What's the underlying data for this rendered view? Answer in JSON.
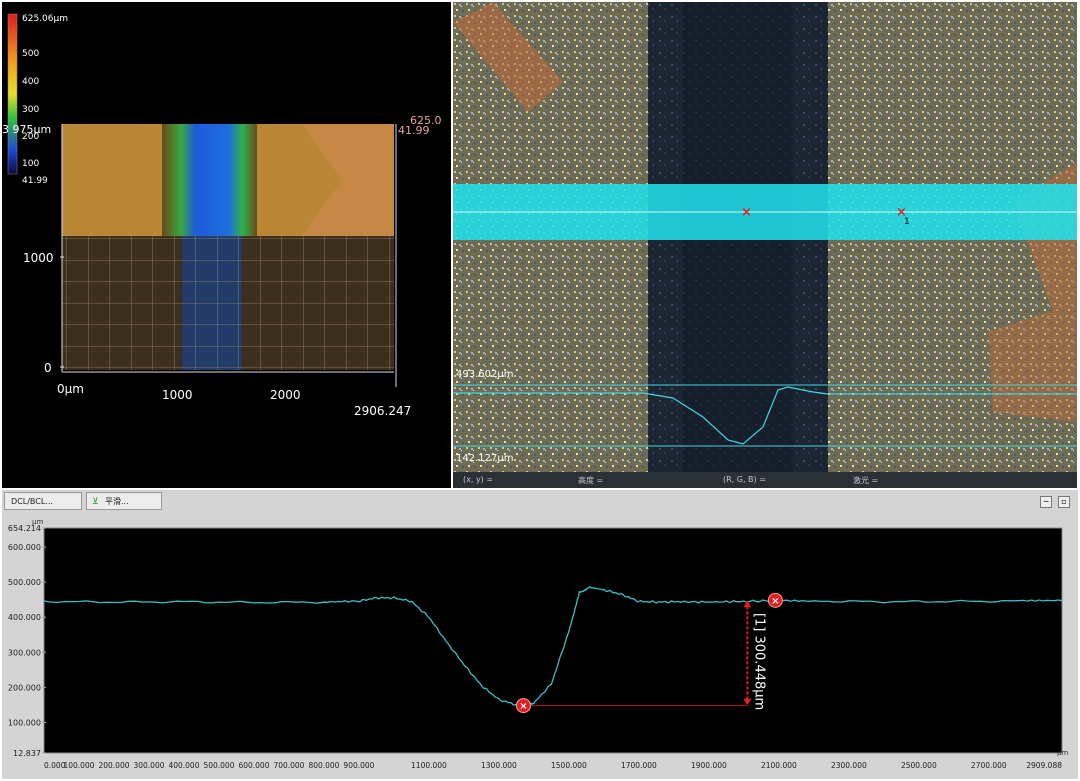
{
  "colorbar": {
    "ticks": [
      "625.06µm",
      "500",
      "400",
      "300",
      "200",
      "100",
      "41.99"
    ]
  },
  "view3d": {
    "z_top_label": "625.0",
    "z_min_label": "41.99",
    "y_axis_label": "3 975µm",
    "y_ticks": [
      "1000",
      "0"
    ],
    "x_ticks": [
      "0µm",
      "1000",
      "2000"
    ],
    "x_end_label": "2906.247"
  },
  "camera_view": {
    "upper_value": "493.602µm",
    "lower_value": "142.127µm",
    "marker_label": "1",
    "status": {
      "xy": "(x, y) =",
      "height": "高度 =",
      "rgb": "(R, G, B) =",
      "laser": "激光 ="
    }
  },
  "profile": {
    "tabs": [
      "DCL/BCL...",
      "平滑..."
    ],
    "unit": "µm",
    "y_ticks": [
      "654.214",
      "600.000",
      "500.000",
      "400.000",
      "300.000",
      "200.000",
      "100.000",
      "12.837"
    ],
    "x_ticks": [
      "0.000",
      "100.000",
      "200.000",
      "300.000",
      "400.000",
      "500.000",
      "600.000",
      "700.000",
      "800.000",
      "900.000",
      "1100.000",
      "1300.000",
      "1500.000",
      "1700.000",
      "1900.000",
      "2100.000",
      "2300.000",
      "2500.000",
      "2700.000",
      "2909.088"
    ],
    "x_unit": "µm",
    "measurement_label": "[1] 300.448µm",
    "colors": {
      "trace": "#3fbdc4",
      "marker": "#e0201f",
      "bg": "#000000"
    }
  },
  "chart_data": {
    "type": "line",
    "xlim": [
      0,
      2909.088
    ],
    "ylim": [
      12.837,
      654.214
    ],
    "x": [
      0,
      200,
      400,
      600,
      800,
      900,
      950,
      1000,
      1050,
      1100,
      1150,
      1200,
      1250,
      1300,
      1350,
      1370,
      1400,
      1450,
      1500,
      1530,
      1560,
      1600,
      1650,
      1700,
      1750,
      1800,
      1900,
      2000,
      2090,
      2200,
      2400,
      2600,
      2800,
      2909
    ],
    "y": [
      445,
      443,
      444,
      442,
      443,
      446,
      455,
      455,
      445,
      400,
      330,
      265,
      205,
      165,
      150,
      148,
      155,
      210,
      360,
      470,
      485,
      478,
      465,
      445,
      443,
      444,
      443,
      445,
      447,
      446,
      444,
      445,
      446,
      447
    ],
    "markers": [
      {
        "x": 1370,
        "y": 148
      },
      {
        "x": 2090,
        "y": 448
      }
    ],
    "measurement": {
      "value": 300.448,
      "unit": "µm"
    }
  }
}
